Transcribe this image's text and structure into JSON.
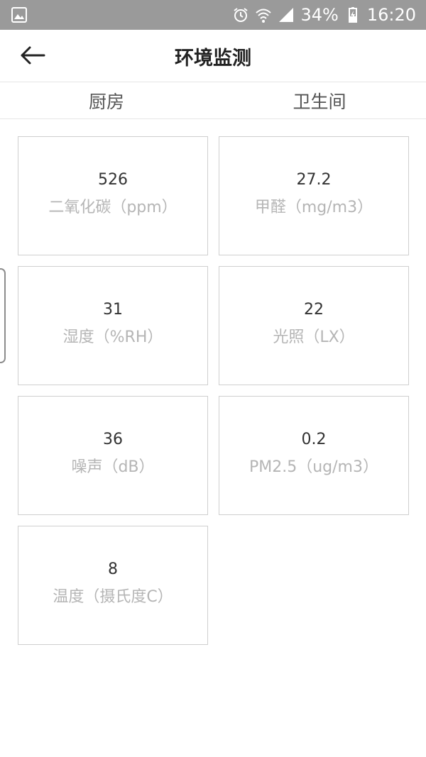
{
  "status_bar": {
    "battery": "34%",
    "time": "16:20",
    "icons": [
      "image-icon",
      "alarm-icon",
      "wifi-icon",
      "signal-icon",
      "battery-charging-icon"
    ]
  },
  "header": {
    "back_icon": "back-arrow-icon",
    "title": "环境监测"
  },
  "tabs": [
    {
      "label": "厨房"
    },
    {
      "label": "卫生间"
    }
  ],
  "readings": [
    {
      "value": "526",
      "label": "二氧化碳（ppm）"
    },
    {
      "value": "27.2",
      "label": "甲醛（mg/m3）"
    },
    {
      "value": "31",
      "label": "湿度（%RH）"
    },
    {
      "value": "22",
      "label": "光照（LX）"
    },
    {
      "value": "36",
      "label": "噪声（dB）"
    },
    {
      "value": "0.2",
      "label": "PM2.5（ug/m3）"
    },
    {
      "value": "8",
      "label": "温度（摄氏度C）"
    }
  ],
  "colors": {
    "status_bar_bg": "#9a9a9a",
    "card_border": "#cfcfcf",
    "value_text": "#333333",
    "label_text": "#b5b5b5"
  }
}
